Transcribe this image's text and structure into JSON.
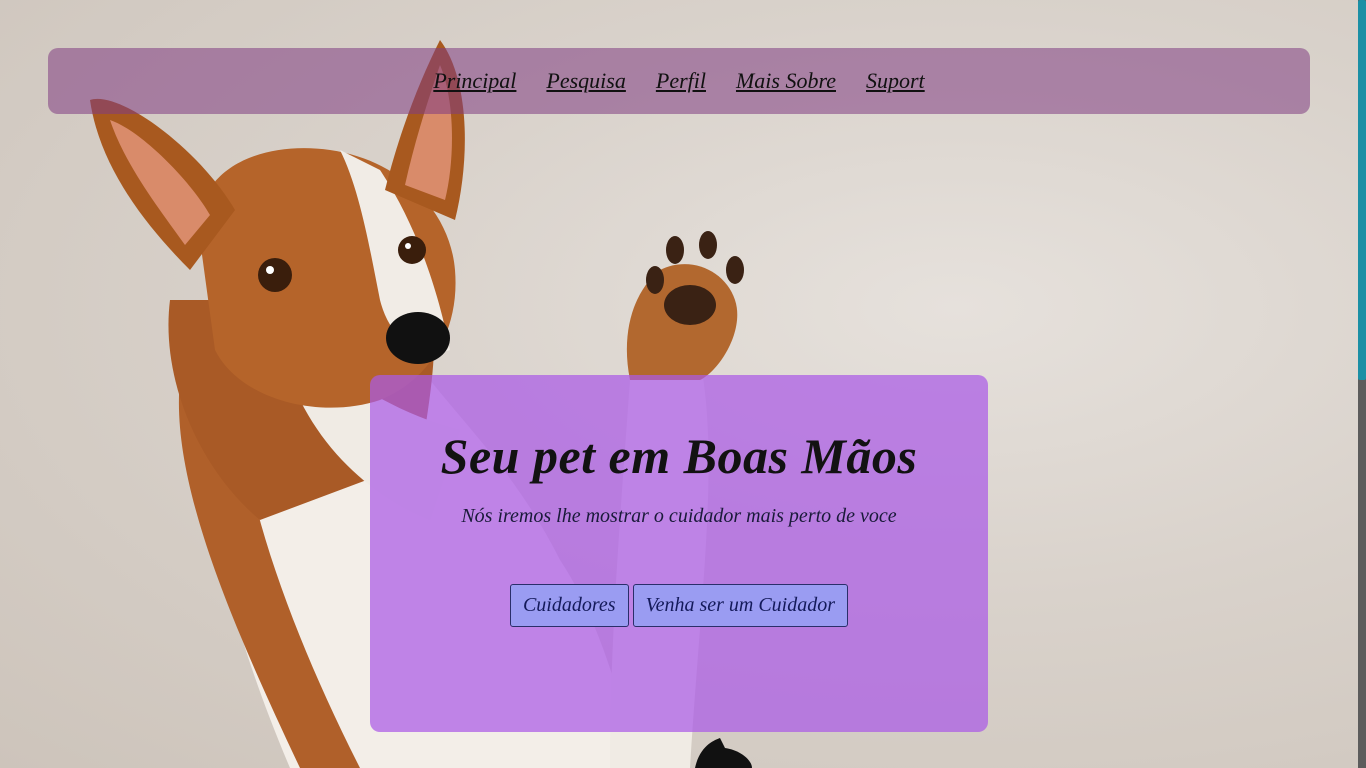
{
  "nav": {
    "items": [
      {
        "label": "Principal"
      },
      {
        "label": "Pesquisa"
      },
      {
        "label": "Perfil"
      },
      {
        "label": "Mais Sobre"
      },
      {
        "label": "Suport"
      }
    ]
  },
  "hero": {
    "title": "Seu pet em Boas Mãos",
    "subtitle": "Nós iremos lhe mostrar o cuidador mais perto de voce",
    "buttons": {
      "caregivers": "Cuidadores",
      "become_caregiver": "Venha ser um Cuidador"
    }
  },
  "colors": {
    "navbar": "#803c82",
    "hero_card": "#aa5ae6",
    "button": "#9a9cf2",
    "scroll_thumb": "#1b8fa5"
  }
}
